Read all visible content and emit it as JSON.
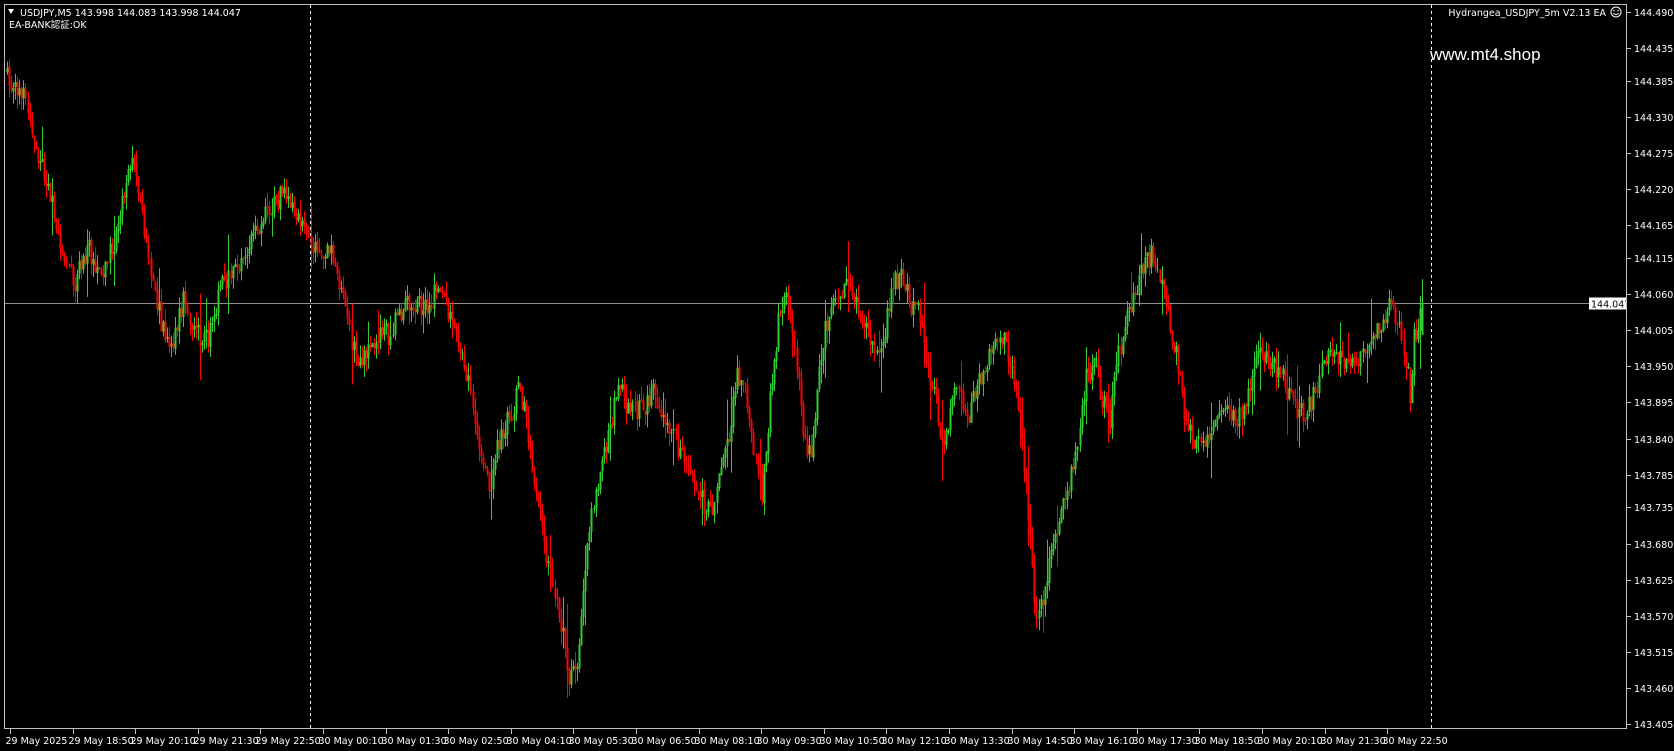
{
  "header": {
    "symbol_line": "USDJPY,M5  143.998 144.083 143.998 144.047",
    "status_line": "EA-BANK認証:OK",
    "ea_label": "Hydrangea_USDJPY_5m V2.13 EA",
    "ea_icon": "smiley-icon",
    "collapse_icon": "triangle-down-icon"
  },
  "watermark": "www.mt4.shop",
  "colors": {
    "background": "#000000",
    "bull": "#32cd32",
    "bear": "#ff0000",
    "axis": "#c0c0c0",
    "text": "#ffffff",
    "price_line": "#c0c0c0",
    "period_separator": "#ffffff"
  },
  "chart_data": {
    "type": "candlestick",
    "symbol": "USDJPY",
    "timeframe": "M5",
    "last_price": "144.047",
    "ohlc": {
      "open": 143.998,
      "high": 144.083,
      "low": 143.998,
      "close": 144.047
    },
    "ylim": [
      143.405,
      144.49
    ],
    "y_ticks": [
      "144.490",
      "144.435",
      "144.385",
      "144.330",
      "144.275",
      "144.220",
      "144.165",
      "144.115",
      "144.060",
      "144.005",
      "143.950",
      "143.895",
      "143.840",
      "143.785",
      "143.735",
      "143.680",
      "143.625",
      "143.570",
      "143.515",
      "143.460",
      "143.405"
    ],
    "x_ticks": [
      "29 May 2025",
      "29 May 18:50",
      "29 May 20:10",
      "29 May 21:30",
      "29 May 22:50",
      "30 May 00:10",
      "30 May 01:30",
      "30 May 02:50",
      "30 May 04:10",
      "30 May 05:30",
      "30 May 06:50",
      "30 May 08:10",
      "30 May 09:30",
      "30 May 10:50",
      "30 May 12:10",
      "30 May 13:30",
      "30 May 14:50",
      "30 May 16:10",
      "30 May 17:30",
      "30 May 18:50",
      "30 May 20:10",
      "30 May 21:30",
      "30 May 22:50"
    ],
    "path_points": [
      [
        0,
        144.39
      ],
      [
        8,
        144.36
      ],
      [
        14,
        144.28
      ],
      [
        20,
        144.22
      ],
      [
        28,
        144.12
      ],
      [
        33,
        144.08
      ],
      [
        40,
        144.13
      ],
      [
        46,
        144.09
      ],
      [
        52,
        144.14
      ],
      [
        58,
        144.23
      ],
      [
        62,
        144.26
      ],
      [
        66,
        144.18
      ],
      [
        70,
        144.1
      ],
      [
        75,
        144.02
      ],
      [
        80,
        143.98
      ],
      [
        86,
        144.05
      ],
      [
        92,
        144.0
      ],
      [
        98,
        143.99
      ],
      [
        104,
        144.07
      ],
      [
        110,
        144.1
      ],
      [
        118,
        144.13
      ],
      [
        124,
        144.17
      ],
      [
        130,
        144.2
      ],
      [
        136,
        144.22
      ],
      [
        140,
        144.19
      ],
      [
        144,
        144.17
      ],
      [
        150,
        144.13
      ],
      [
        154,
        144.13
      ],
      [
        158,
        144.12
      ],
      [
        162,
        144.08
      ],
      [
        168,
        143.98
      ],
      [
        172,
        143.95
      ],
      [
        176,
        143.97
      ],
      [
        180,
        143.99
      ],
      [
        186,
        144.0
      ],
      [
        192,
        144.03
      ],
      [
        198,
        144.05
      ],
      [
        204,
        144.04
      ],
      [
        210,
        144.07
      ],
      [
        216,
        144.02
      ],
      [
        222,
        143.98
      ],
      [
        228,
        143.86
      ],
      [
        232,
        143.8
      ],
      [
        236,
        143.76
      ],
      [
        240,
        143.84
      ],
      [
        245,
        143.87
      ],
      [
        250,
        143.92
      ],
      [
        254,
        143.84
      ],
      [
        258,
        143.76
      ],
      [
        262,
        143.68
      ],
      [
        266,
        143.63
      ],
      [
        270,
        143.56
      ],
      [
        274,
        143.48
      ],
      [
        278,
        143.5
      ],
      [
        282,
        143.64
      ],
      [
        286,
        143.75
      ],
      [
        290,
        143.8
      ],
      [
        294,
        143.86
      ],
      [
        298,
        143.92
      ],
      [
        304,
        143.88
      ],
      [
        310,
        143.89
      ],
      [
        316,
        143.91
      ],
      [
        320,
        143.87
      ],
      [
        326,
        143.84
      ],
      [
        330,
        143.8
      ],
      [
        336,
        143.76
      ],
      [
        340,
        143.74
      ],
      [
        344,
        143.74
      ],
      [
        348,
        143.78
      ],
      [
        352,
        143.85
      ],
      [
        356,
        143.94
      ],
      [
        360,
        143.91
      ],
      [
        364,
        143.83
      ],
      [
        368,
        143.76
      ],
      [
        372,
        143.9
      ],
      [
        376,
        144.02
      ],
      [
        380,
        144.06
      ],
      [
        384,
        143.98
      ],
      [
        388,
        143.85
      ],
      [
        392,
        143.81
      ],
      [
        396,
        143.95
      ],
      [
        400,
        144.02
      ],
      [
        404,
        144.05
      ],
      [
        408,
        144.08
      ],
      [
        412,
        144.05
      ],
      [
        416,
        144.03
      ],
      [
        420,
        144.0
      ],
      [
        424,
        143.96
      ],
      [
        428,
        144.01
      ],
      [
        432,
        144.07
      ],
      [
        436,
        144.1
      ],
      [
        440,
        144.05
      ],
      [
        444,
        144.03
      ],
      [
        448,
        143.97
      ],
      [
        452,
        143.91
      ],
      [
        456,
        143.82
      ],
      [
        460,
        143.88
      ],
      [
        464,
        143.92
      ],
      [
        468,
        143.87
      ],
      [
        472,
        143.91
      ],
      [
        476,
        143.94
      ],
      [
        480,
        143.98
      ],
      [
        484,
        144.0
      ],
      [
        488,
        143.97
      ],
      [
        492,
        143.93
      ],
      [
        496,
        143.8
      ],
      [
        500,
        143.65
      ],
      [
        502,
        143.55
      ],
      [
        506,
        143.62
      ],
      [
        510,
        143.67
      ],
      [
        514,
        143.72
      ],
      [
        518,
        143.77
      ],
      [
        522,
        143.84
      ],
      [
        526,
        143.93
      ],
      [
        530,
        143.96
      ],
      [
        534,
        143.9
      ],
      [
        538,
        143.87
      ],
      [
        542,
        143.97
      ],
      [
        546,
        144.03
      ],
      [
        550,
        144.07
      ],
      [
        554,
        144.1
      ],
      [
        558,
        144.12
      ],
      [
        562,
        144.08
      ],
      [
        566,
        144.03
      ],
      [
        570,
        143.97
      ],
      [
        574,
        143.88
      ],
      [
        578,
        143.84
      ],
      [
        582,
        143.83
      ],
      [
        586,
        143.84
      ],
      [
        590,
        143.88
      ],
      [
        594,
        143.9
      ],
      [
        598,
        143.88
      ],
      [
        602,
        143.87
      ],
      [
        606,
        143.92
      ],
      [
        610,
        143.97
      ],
      [
        614,
        143.96
      ],
      [
        618,
        143.95
      ],
      [
        622,
        143.93
      ],
      [
        626,
        143.9
      ],
      [
        630,
        143.88
      ],
      [
        634,
        143.88
      ],
      [
        638,
        143.91
      ],
      [
        642,
        143.95
      ],
      [
        646,
        143.97
      ],
      [
        650,
        143.96
      ],
      [
        654,
        143.95
      ],
      [
        658,
        143.96
      ],
      [
        662,
        143.98
      ],
      [
        666,
        144.0
      ],
      [
        670,
        144.02
      ],
      [
        674,
        144.04
      ],
      [
        678,
        144.02
      ],
      [
        682,
        143.96
      ],
      [
        684,
        143.91
      ],
      [
        686,
        143.99
      ],
      [
        688,
        144.02
      ],
      [
        690,
        144.05
      ]
    ]
  }
}
